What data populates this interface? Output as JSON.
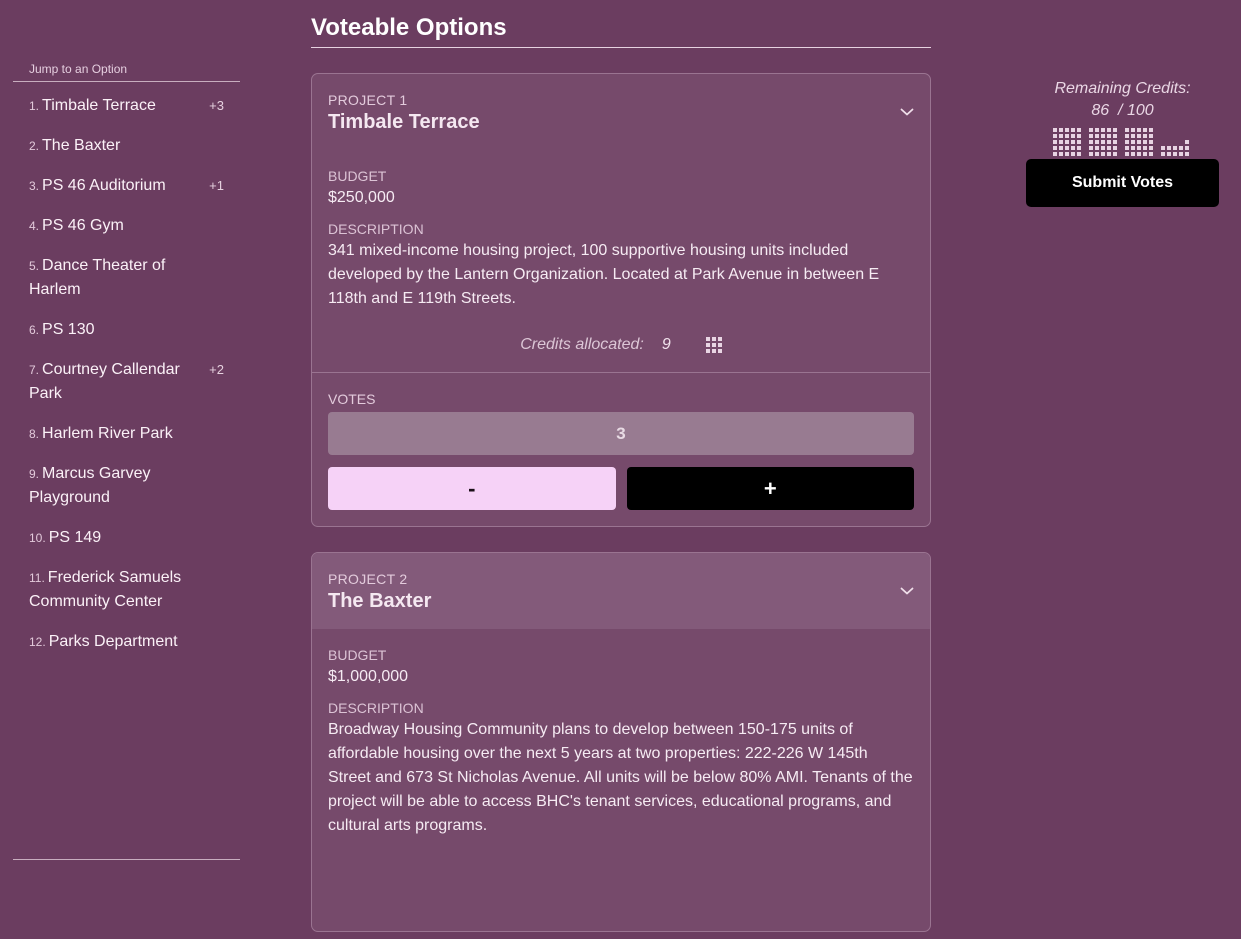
{
  "sidebar": {
    "header": "Jump to an Option",
    "items": [
      {
        "num": "1.",
        "label": "Timbale Terrace",
        "delta": "+3"
      },
      {
        "num": "2.",
        "label": "The Baxter",
        "delta": ""
      },
      {
        "num": "3.",
        "label": "PS 46 Auditorium",
        "delta": "+1"
      },
      {
        "num": "4.",
        "label": "PS 46 Gym",
        "delta": ""
      },
      {
        "num": "5.",
        "label": "Dance Theater of Harlem",
        "delta": ""
      },
      {
        "num": "6.",
        "label": "PS 130",
        "delta": ""
      },
      {
        "num": "7.",
        "label": "Courtney Callendar Park",
        "delta": "+2"
      },
      {
        "num": "8.",
        "label": "Harlem River Park",
        "delta": ""
      },
      {
        "num": "9.",
        "label": "Marcus Garvey Playground",
        "delta": ""
      },
      {
        "num": "10.",
        "label": "PS 149",
        "delta": ""
      },
      {
        "num": "11.",
        "label": "Frederick Samuels Community Center",
        "delta": ""
      },
      {
        "num": "12.",
        "label": "Parks Department",
        "delta": ""
      }
    ]
  },
  "main": {
    "title": "Voteable Options",
    "projects": [
      {
        "number": "PROJECT 1",
        "title": "Timbale Terrace",
        "budget_label": "BUDGET",
        "budget": "$250,000",
        "description_label": "DESCRIPTION",
        "description": "341 mixed-income housing project, 100 supportive housing units included developed by the Lantern Organization. Located at Park Avenue in between E 118th and E 119th Streets.",
        "credits_label": "Credits allocated:",
        "credits": "9",
        "votes_label": "VOTES",
        "votes": "3",
        "minus_label": "-",
        "plus_label": "+"
      },
      {
        "number": "PROJECT 2",
        "title": "The Baxter",
        "budget_label": "BUDGET",
        "budget": "$1,000,000",
        "description_label": "DESCRIPTION",
        "description": "Broadway Housing Community plans to develop between 150-175 units of affordable housing over the next 5 years at two properties: 222-226 W 145th Street and 673 St Nicholas Avenue. All units will be below 80% AMI. Tenants of the project will be able to access BHC's tenant services, educational programs, and cultural arts programs."
      }
    ]
  },
  "credits_panel": {
    "label": "Remaining Credits:",
    "remaining": "86",
    "total": "100",
    "submit_label": "Submit Votes"
  },
  "icons": {
    "chevron": "chevron-down-icon",
    "credit_grid": "credit-grid-icon",
    "credit_blocks": "credit-blocks-icon"
  },
  "colors": {
    "background": "#6b3d60",
    "card": "#764a6b",
    "minus_button": "#f6d2f7",
    "plus_button": "#000000"
  }
}
